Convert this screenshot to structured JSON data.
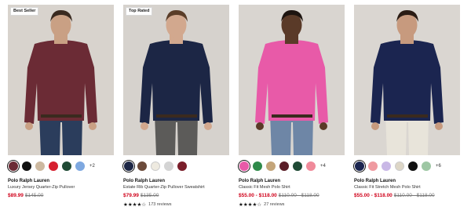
{
  "products": [
    {
      "badge": "Best Seller",
      "brand": "Polo Ralph Lauren",
      "name": "Luxury Jersey Quarter-Zip Pullover",
      "sale_price": "$89.99",
      "orig_price": "$145.00",
      "more_colors": "+2",
      "rating": {
        "stars": "",
        "reviews": ""
      },
      "colors": {
        "bg": "#d8d3cd",
        "top": "#6b2b35",
        "pants": "#2b3d5c",
        "skin": "#c9a084",
        "hair": "#3a2a20"
      },
      "swatches": [
        {
          "color": "#6b2b35",
          "selected": true
        },
        {
          "color": "#111111",
          "selected": false
        },
        {
          "color": "#cdb9a0",
          "selected": false
        },
        {
          "color": "#d6202f",
          "selected": false
        },
        {
          "color": "#1f4a35",
          "selected": false
        },
        {
          "color": "#7ea8e0",
          "selected": false
        }
      ]
    },
    {
      "badge": "Top Rated",
      "brand": "Polo Ralph Lauren",
      "name": "Estate Rib Quarter-Zip Pullover Sweatshirt",
      "sale_price": "$79.99",
      "orig_price": "$135.00",
      "more_colors": "",
      "rating": {
        "stars": "★★★★☆",
        "reviews": "173 reviews"
      },
      "colors": {
        "bg": "#d6d2cd",
        "top": "#1c2645",
        "pants": "#5c5b59",
        "skin": "#d2a88e",
        "hair": "#5a3d28"
      },
      "swatches": [
        {
          "color": "#1c2645",
          "selected": true
        },
        {
          "color": "#6b4a3a",
          "selected": false
        },
        {
          "color": "#eeeae0",
          "selected": false
        },
        {
          "color": "#d4d4d4",
          "selected": false
        },
        {
          "color": "#7a1e2a",
          "selected": false
        }
      ]
    },
    {
      "badge": "",
      "brand": "Polo Ralph Lauren",
      "name": "Classic Fit Mesh Polo Shirt",
      "sale_price": "$55.00 - $118.00",
      "orig_price": "$110.00 - $118.00",
      "more_colors": "+4",
      "rating": {
        "stars": "★★★★☆",
        "reviews": "27 reviews"
      },
      "colors": {
        "bg": "#d9d5d0",
        "top": "#e85aa8",
        "pants": "#6e86a6",
        "skin": "#5a3a28",
        "hair": "#1d1410"
      },
      "swatches": [
        {
          "color": "#e85aa8",
          "selected": true
        },
        {
          "color": "#2f8a4a",
          "selected": false
        },
        {
          "color": "#c4a57a",
          "selected": false
        },
        {
          "color": "#5a1e28",
          "selected": false
        },
        {
          "color": "#1f4a35",
          "selected": false
        },
        {
          "color": "#f08a9a",
          "selected": false
        }
      ]
    },
    {
      "badge": "",
      "brand": "Polo Ralph Lauren",
      "name": "Classic Fit Stretch Mesh Polo Shirt",
      "sale_price": "$55.00 - $118.00",
      "orig_price": "$110.00 - $118.00",
      "more_colors": "+6",
      "rating": {
        "stars": "",
        "reviews": ""
      },
      "colors": {
        "bg": "#dad6d1",
        "top": "#1b2550",
        "pants": "#e8e4da",
        "skin": "#c79a7e",
        "hair": "#2a1c14"
      },
      "swatches": [
        {
          "color": "#1b2550",
          "selected": true
        },
        {
          "color": "#ef9aa0",
          "selected": false
        },
        {
          "color": "#c9b8e6",
          "selected": false
        },
        {
          "color": "#ddd6c6",
          "selected": false
        },
        {
          "color": "#111111",
          "selected": false
        },
        {
          "color": "#9ec7a4",
          "selected": false
        }
      ]
    }
  ]
}
